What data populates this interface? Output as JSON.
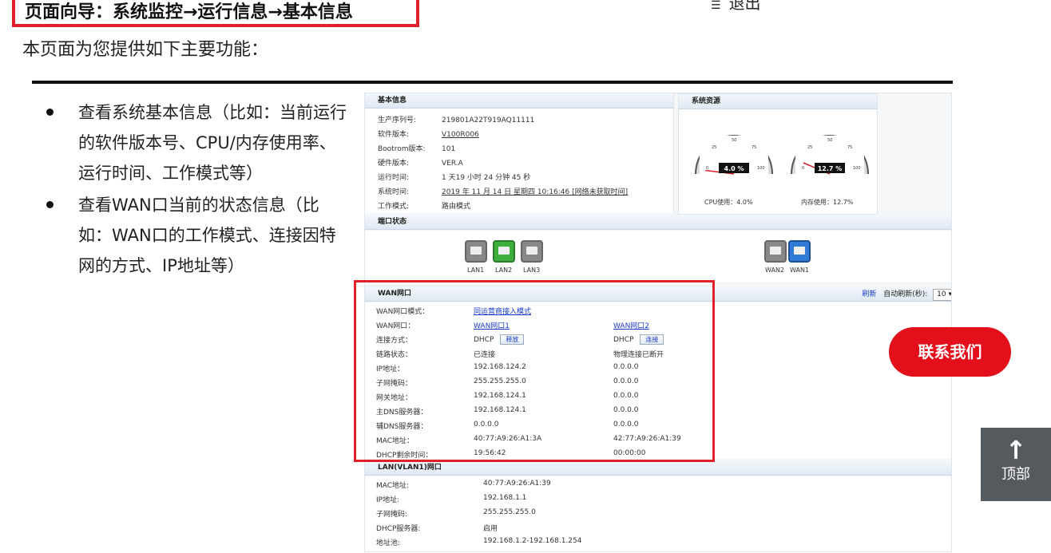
{
  "header": {
    "nav_title": "页面向导：系统监控→运行信息→基本信息",
    "logout_label": "退出",
    "intro": "本页面为您提供如下主要功能："
  },
  "bullets": [
    "查看系统基本信息（比如：当前运行的软件版本号、CPU/内存使用率、运行时间、工作模式等）",
    "查看WAN口当前的状态信息（比如：WAN口的工作模式、连接因特网的方式、IP地址等）"
  ],
  "basic": {
    "title": "基本信息",
    "items": [
      {
        "k": "生产序列号:",
        "v": "219801A22T919AQ11111"
      },
      {
        "k": "软件版本:",
        "v": "V100R006"
      },
      {
        "k": "Bootrom版本:",
        "v": "101"
      },
      {
        "k": "硬件版本:",
        "v": "VER.A"
      },
      {
        "k": "运行时间:",
        "v": "1 天19 小时 24 分钟 45 秒"
      },
      {
        "k": "系统时间:",
        "v": "2019 年 11 月 14 日 星期四 10:16:46 [网络未获取时间]"
      },
      {
        "k": "工作模式:",
        "v": "路由模式"
      }
    ]
  },
  "resource": {
    "title": "系统资源",
    "cpu_value": "4.0 %",
    "cpu_label": "CPU使用：4.0%",
    "cpu_percent": 4.0,
    "mem_value": "12.7 %",
    "mem_label": "内存使用：12.7%",
    "mem_percent": 12.7,
    "gauge_ticks": [
      "0",
      "25",
      "50",
      "75",
      "100"
    ]
  },
  "ports": {
    "title": "端口状态",
    "lan": [
      "LAN1",
      "LAN2",
      "LAN3"
    ],
    "wan": [
      "WAN2",
      "WAN1"
    ]
  },
  "wan": {
    "title": "WAN网口",
    "refresh_link": "刷新",
    "auto_refresh_label": "自动刷新(秒):",
    "auto_refresh_value": "10",
    "mode_label": "WAN网口模式：",
    "mode_value": "同运营商接入模式",
    "port_label": "WAN网口：",
    "port1": "WAN网口1",
    "port2": "WAN网口2",
    "conn_label": "连接方式：",
    "conn1": "DHCP",
    "conn1_btn": "释放",
    "conn2": "DHCP",
    "conn2_btn": "连接",
    "link_label": "链路状态：",
    "link1": "已连接",
    "link2": "物理连接已断开",
    "rows": [
      {
        "k": "IP地址：",
        "v1": "192.168.124.2",
        "v2": "0.0.0.0"
      },
      {
        "k": "子网掩码：",
        "v1": "255.255.255.0",
        "v2": "0.0.0.0"
      },
      {
        "k": "网关地址：",
        "v1": "192.168.124.1",
        "v2": "0.0.0.0"
      },
      {
        "k": "主DNS服务器：",
        "v1": "192.168.124.1",
        "v2": "0.0.0.0"
      },
      {
        "k": "辅DNS服务器：",
        "v1": "0.0.0.0",
        "v2": "0.0.0.0"
      },
      {
        "k": "MAC地址：",
        "v1": "40:77:A9:26:A1:3A",
        "v2": "42:77:A9:26:A1:39"
      },
      {
        "k": "DHCP剩余时间：",
        "v1": "19:56:42",
        "v2": "00:00:00"
      }
    ]
  },
  "lan": {
    "title": "LAN(VLAN1)网口",
    "rows": [
      {
        "k": "MAC地址:",
        "v": "40:77:A9:26:A1:39"
      },
      {
        "k": "IP地址:",
        "v": "192.168.1.1"
      },
      {
        "k": "子网掩码:",
        "v": "255.255.255.0"
      },
      {
        "k": "DHCP服务器:",
        "v": "启用"
      },
      {
        "k": "地址池:",
        "v": "192.168.1.2-192.168.1.254"
      }
    ]
  },
  "side": {
    "contact": "联系我们",
    "top": "顶部"
  },
  "colors": {
    "highlight": "#e0202a",
    "contact_bg": "#e3101b",
    "port_green": "#3cae3c",
    "port_blue": "#2f7bd6",
    "port_gray": "#8a8a8a"
  }
}
